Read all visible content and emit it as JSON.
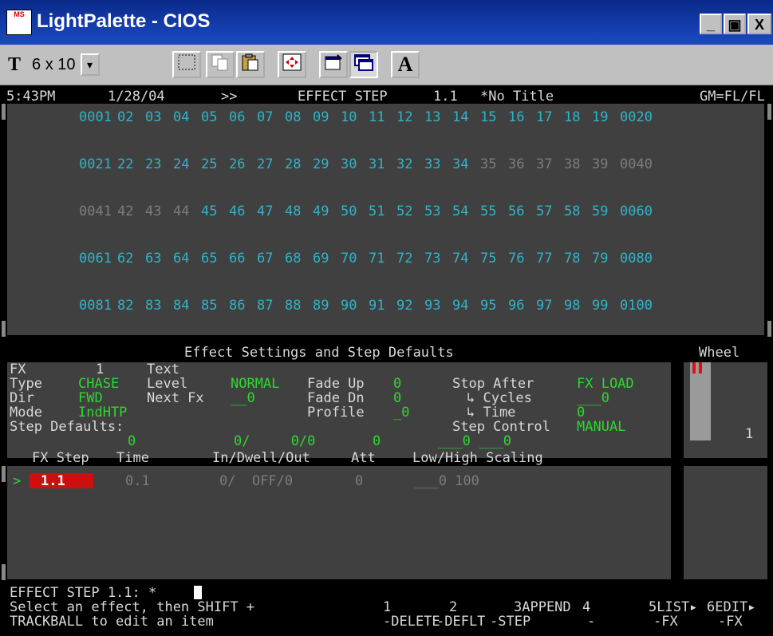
{
  "window": {
    "logo": "MS",
    "title": "LightPalette - CIOS",
    "min_label": "_",
    "max_label": "▣",
    "close_label": "X"
  },
  "toolbar": {
    "font_icon_label": "T",
    "font_size": "6 x 10",
    "font_dropdown": "▾",
    "a_button": "A"
  },
  "status": {
    "time": "5:43PM",
    "date": "1/28/04",
    "arrows": ">>",
    "mode": "EFFECT STEP",
    "step": "1.1",
    "show_title": "*No Title",
    "gm": "GM=FL/FL"
  },
  "channels": [
    {
      "ch": "0001",
      "s": "on"
    },
    {
      "ch": "02",
      "s": "on"
    },
    {
      "ch": "03",
      "s": "on"
    },
    {
      "ch": "04",
      "s": "on"
    },
    {
      "ch": "05",
      "s": "on"
    },
    {
      "ch": "06",
      "s": "on"
    },
    {
      "ch": "07",
      "s": "on"
    },
    {
      "ch": "08",
      "s": "on"
    },
    {
      "ch": "09",
      "s": "on"
    },
    {
      "ch": "10",
      "s": "on"
    },
    {
      "ch": "11",
      "s": "on"
    },
    {
      "ch": "12",
      "s": "on"
    },
    {
      "ch": "13",
      "s": "on"
    },
    {
      "ch": "14",
      "s": "on"
    },
    {
      "ch": "15",
      "s": "on"
    },
    {
      "ch": "16",
      "s": "on"
    },
    {
      "ch": "17",
      "s": "on"
    },
    {
      "ch": "18",
      "s": "on"
    },
    {
      "ch": "19",
      "s": "on"
    },
    {
      "ch": "0020",
      "s": "on"
    },
    {
      "ch": "0021",
      "s": "on"
    },
    {
      "ch": "22",
      "s": "on"
    },
    {
      "ch": "23",
      "s": "on"
    },
    {
      "ch": "24",
      "s": "on"
    },
    {
      "ch": "25",
      "s": "on"
    },
    {
      "ch": "26",
      "s": "on"
    },
    {
      "ch": "27",
      "s": "on"
    },
    {
      "ch": "28",
      "s": "on"
    },
    {
      "ch": "29",
      "s": "on"
    },
    {
      "ch": "30",
      "s": "on"
    },
    {
      "ch": "31",
      "s": "on"
    },
    {
      "ch": "32",
      "s": "on"
    },
    {
      "ch": "33",
      "s": "on"
    },
    {
      "ch": "34",
      "s": "on"
    },
    {
      "ch": "35",
      "s": "dim"
    },
    {
      "ch": "36",
      "s": "dim"
    },
    {
      "ch": "37",
      "s": "dim"
    },
    {
      "ch": "38",
      "s": "dim"
    },
    {
      "ch": "39",
      "s": "dim"
    },
    {
      "ch": "0040",
      "s": "dim"
    },
    {
      "ch": "0041",
      "s": "dim"
    },
    {
      "ch": "42",
      "s": "dim"
    },
    {
      "ch": "43",
      "s": "dim"
    },
    {
      "ch": "44",
      "s": "dim"
    },
    {
      "ch": "45",
      "s": "on"
    },
    {
      "ch": "46",
      "s": "on"
    },
    {
      "ch": "47",
      "s": "on"
    },
    {
      "ch": "48",
      "s": "on"
    },
    {
      "ch": "49",
      "s": "on"
    },
    {
      "ch": "50",
      "s": "on"
    },
    {
      "ch": "51",
      "s": "on"
    },
    {
      "ch": "52",
      "s": "on"
    },
    {
      "ch": "53",
      "s": "on"
    },
    {
      "ch": "54",
      "s": "on"
    },
    {
      "ch": "55",
      "s": "on"
    },
    {
      "ch": "56",
      "s": "on"
    },
    {
      "ch": "57",
      "s": "on"
    },
    {
      "ch": "58",
      "s": "on"
    },
    {
      "ch": "59",
      "s": "on"
    },
    {
      "ch": "0060",
      "s": "on"
    },
    {
      "ch": "0061",
      "s": "on"
    },
    {
      "ch": "62",
      "s": "on"
    },
    {
      "ch": "63",
      "s": "on"
    },
    {
      "ch": "64",
      "s": "on"
    },
    {
      "ch": "65",
      "s": "on"
    },
    {
      "ch": "66",
      "s": "on"
    },
    {
      "ch": "67",
      "s": "on"
    },
    {
      "ch": "68",
      "s": "on"
    },
    {
      "ch": "69",
      "s": "on"
    },
    {
      "ch": "70",
      "s": "on"
    },
    {
      "ch": "71",
      "s": "on"
    },
    {
      "ch": "72",
      "s": "on"
    },
    {
      "ch": "73",
      "s": "on"
    },
    {
      "ch": "74",
      "s": "on"
    },
    {
      "ch": "75",
      "s": "on"
    },
    {
      "ch": "76",
      "s": "on"
    },
    {
      "ch": "77",
      "s": "on"
    },
    {
      "ch": "78",
      "s": "on"
    },
    {
      "ch": "79",
      "s": "on"
    },
    {
      "ch": "0080",
      "s": "on"
    },
    {
      "ch": "0081",
      "s": "on"
    },
    {
      "ch": "82",
      "s": "on"
    },
    {
      "ch": "83",
      "s": "on"
    },
    {
      "ch": "84",
      "s": "on"
    },
    {
      "ch": "85",
      "s": "on"
    },
    {
      "ch": "86",
      "s": "on"
    },
    {
      "ch": "87",
      "s": "on"
    },
    {
      "ch": "88",
      "s": "on"
    },
    {
      "ch": "89",
      "s": "on"
    },
    {
      "ch": "90",
      "s": "on"
    },
    {
      "ch": "91",
      "s": "on"
    },
    {
      "ch": "92",
      "s": "on"
    },
    {
      "ch": "93",
      "s": "on"
    },
    {
      "ch": "94",
      "s": "on"
    },
    {
      "ch": "95",
      "s": "on"
    },
    {
      "ch": "96",
      "s": "on"
    },
    {
      "ch": "97",
      "s": "on"
    },
    {
      "ch": "98",
      "s": "on"
    },
    {
      "ch": "99",
      "s": "on"
    },
    {
      "ch": "0100",
      "s": "on"
    }
  ],
  "settings": {
    "header": "Effect Settings and Step Defaults",
    "wheel": "Wheel",
    "fx_label": "FX",
    "fx_value": "1",
    "text_label": "Text",
    "type_label": "Type",
    "type_value": "CHASE",
    "level_label": "Level",
    "level_value": "NORMAL",
    "fade_up_label": "Fade Up",
    "fade_up_value": "0",
    "stop_after_label": "Stop After",
    "stop_after_value": "FX LOAD",
    "dir_label": "Dir",
    "dir_value": "FWD",
    "next_fx_label": "Next Fx",
    "next_fx_value": "__0",
    "fade_dn_label": "Fade Dn",
    "fade_dn_value": "0",
    "cycles_label": "↳ Cycles",
    "cycles_value": "___0",
    "mode_label": "Mode",
    "mode_value": "IndHTP",
    "profile_label": "Profile",
    "profile_value": "_0",
    "time_label": "↳ Time",
    "time_value": "0",
    "step_defaults_label": "Step Defaults:",
    "step_control_label": "Step Control",
    "step_control_value": "MANUAL",
    "defaults_row": "0            0/     0/0       0       ___0 ___0",
    "wheel_value": "1"
  },
  "steps": {
    "headers": [
      "FX Step",
      "Time",
      "In/Dwell/Out",
      "Att",
      "Low/High Scaling"
    ],
    "rows": [
      {
        "marker": ">",
        "step": "1.1",
        "time": "0.1",
        "idwo": "0/  OFF/0",
        "att": "0",
        "scaling": "___0 100"
      }
    ]
  },
  "command": {
    "line": "EFFECT STEP 1.1: *",
    "help1": "Select an effect, then SHIFT +",
    "help2": "TRACKBALL to edit an item"
  },
  "softkeys": [
    {
      "top": "1",
      "bottom": "-DELETE"
    },
    {
      "top": "2",
      "bottom": "-DEFLT"
    },
    {
      "top": "3APPEND",
      "bottom": "-STEP"
    },
    {
      "top": "4",
      "bottom": "-"
    },
    {
      "top": "5LIST▸",
      "bottom": "-FX"
    },
    {
      "top": "6EDIT▸",
      "bottom": "-FX"
    }
  ]
}
